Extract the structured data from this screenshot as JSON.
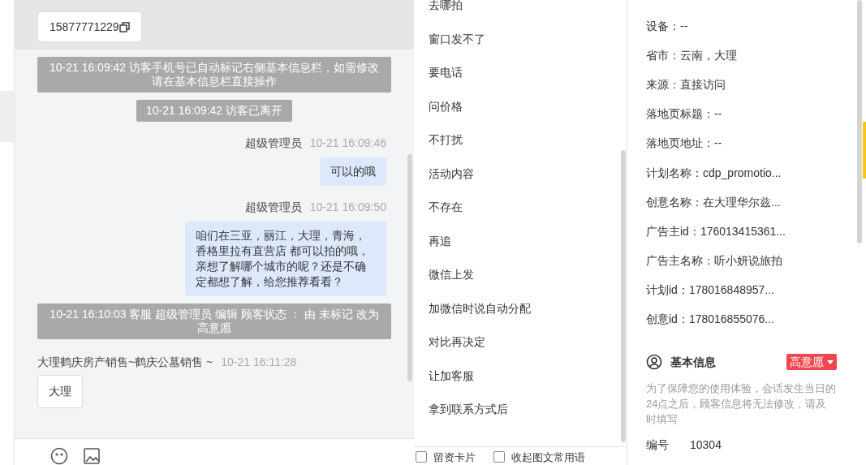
{
  "chat": {
    "messages": [
      {
        "kind": "card",
        "highlighted": true,
        "text": "15877771229"
      },
      {
        "kind": "system",
        "text": "10-21 16:09:42 访客手机号已自动标记右侧基本信息栏，如需修改请在基本信息栏直接操作"
      },
      {
        "kind": "system",
        "text": "10-21 16:09:42 访客已离开"
      },
      {
        "kind": "agent",
        "name": "超级管理员",
        "time": "10-21 16:09:46",
        "text": "可以的哦"
      },
      {
        "kind": "agent",
        "name": "超级管理员",
        "time": "10-21 16:09:50",
        "text": "咱们在三亚，丽江，大理，青海，香格里拉有直营店 都可以拍的哦，亲想了解哪个城市的呢？还是不确定都想了解，给您推荐看看？"
      },
      {
        "kind": "system",
        "text": "10-21 16:10:03 客服 超级管理员 编辑 顾客状态 ： 由 未标记 改为高意愿"
      },
      {
        "kind": "visitor",
        "name": "大理鹤庆房产销售~鹤庆公墓销售 ~",
        "time": "10-21 16:11:28",
        "text": "大理"
      }
    ]
  },
  "quick_replies": {
    "items": [
      "去哪拍",
      "窗口发不了",
      "要电话",
      "问价格",
      "不打扰",
      "活动内容",
      "不存在",
      "再追",
      "微信上发",
      "加微信时说自动分配",
      "对比再决定",
      "让加客服",
      "拿到联系方式后"
    ],
    "options": [
      {
        "label": "留资卡片",
        "checked": false
      },
      {
        "label": "收起图文常用语",
        "checked": false
      }
    ]
  },
  "visitor_info": {
    "fields": [
      "设备：--",
      "省市：云南，大理",
      "来源：直接访问",
      "落地页标题：--",
      "落地页地址：--",
      "计划名称：cdp_promotio...",
      "创意名称：在大理华尔兹...",
      "广告主id：176013415361...",
      "广告主名称：听小妍说旅拍",
      "计划id：178016848957...",
      "创意id：178016855076..."
    ],
    "basic": {
      "title": "基本信息",
      "status": {
        "label": "高意愿",
        "color": "#f0464f"
      },
      "note": "为了保障您的使用体验，会话发生当日的24点之后，顾客信息将无法修改，请及时填写",
      "fields": [
        {
          "label": "编号",
          "value": "10304"
        }
      ]
    }
  }
}
